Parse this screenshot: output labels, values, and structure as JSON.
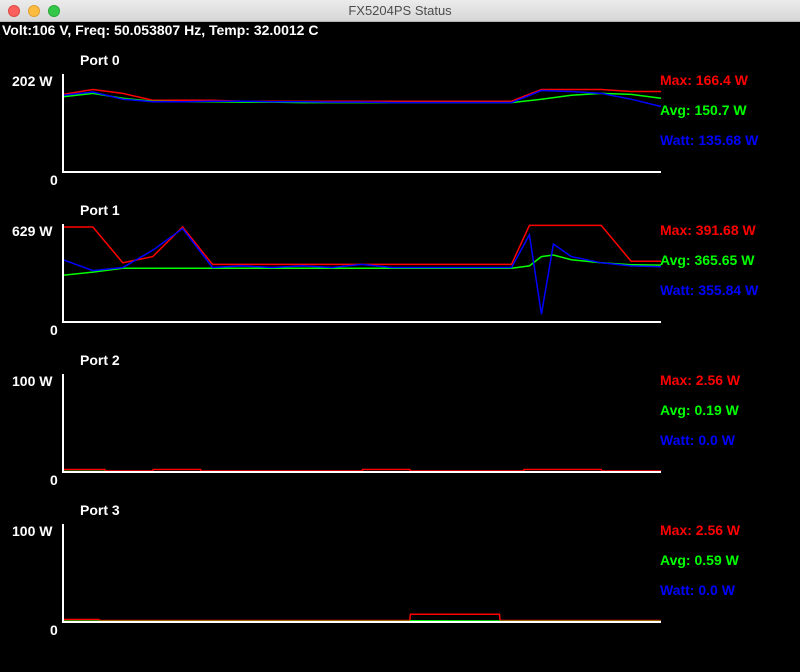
{
  "window": {
    "title": "FX5204PS Status"
  },
  "status": {
    "text": "Volt:106 V, Freq: 50.053807 Hz, Temp: 32.0012 C"
  },
  "colors": {
    "max": "#ff0000",
    "avg": "#00ff00",
    "watt": "#0000ff",
    "axis": "#ffffff"
  },
  "ports": [
    {
      "title": "Port 0",
      "ymax_label": "202 W",
      "yzero_label": "0",
      "max_label": "Max: 166.4 W",
      "avg_label": "Avg: 150.7 W",
      "watt_label": "Watt: 135.68 W"
    },
    {
      "title": "Port 1",
      "ymax_label": "629 W",
      "yzero_label": "0",
      "max_label": "Max: 391.68 W",
      "avg_label": "Avg: 365.65 W",
      "watt_label": "Watt: 355.84 W"
    },
    {
      "title": "Port 2",
      "ymax_label": "100 W",
      "yzero_label": "0",
      "max_label": "Max: 2.56 W",
      "avg_label": "Avg: 0.19 W",
      "watt_label": "Watt: 0.0 W"
    },
    {
      "title": "Port 3",
      "ymax_label": "100 W",
      "yzero_label": "0",
      "max_label": "Max: 2.56 W",
      "avg_label": "Avg: 0.59 W",
      "watt_label": "Watt: 0.0 W"
    }
  ],
  "chart_data": [
    {
      "type": "line",
      "title": "Port 0",
      "ylim": [
        0,
        202
      ],
      "x": [
        0,
        5,
        10,
        15,
        20,
        25,
        30,
        35,
        40,
        45,
        50,
        55,
        60,
        65,
        70,
        75,
        80,
        85,
        90,
        95,
        100
      ],
      "series": [
        {
          "name": "Max",
          "values": [
            160,
            170,
            162,
            148,
            148,
            148,
            146,
            146,
            146,
            146,
            146,
            146,
            146,
            146,
            146,
            146,
            170,
            170,
            170,
            166,
            166
          ]
        },
        {
          "name": "Avg",
          "values": [
            155,
            162,
            152,
            146,
            145,
            145,
            144,
            144,
            143,
            143,
            143,
            143,
            143,
            143,
            143,
            143,
            150,
            158,
            162,
            160,
            152
          ]
        },
        {
          "name": "Watt",
          "values": [
            158,
            165,
            150,
            145,
            145,
            146,
            146,
            145,
            145,
            144,
            144,
            143,
            143,
            143,
            143,
            143,
            168,
            166,
            162,
            150,
            135
          ]
        }
      ]
    },
    {
      "type": "line",
      "title": "Port 1",
      "ylim": [
        0,
        629
      ],
      "x": [
        0,
        5,
        10,
        15,
        20,
        25,
        30,
        35,
        40,
        45,
        50,
        55,
        60,
        65,
        70,
        75,
        78,
        80,
        82,
        85,
        90,
        95,
        100
      ],
      "series": [
        {
          "name": "Max",
          "values": [
            610,
            610,
            380,
            420,
            610,
            370,
            370,
            370,
            370,
            370,
            370,
            370,
            370,
            370,
            370,
            370,
            620,
            620,
            620,
            620,
            620,
            390,
            390
          ]
        },
        {
          "name": "Avg",
          "values": [
            300,
            320,
            345,
            345,
            345,
            345,
            345,
            345,
            345,
            345,
            345,
            345,
            345,
            345,
            345,
            345,
            360,
            420,
            430,
            400,
            380,
            368,
            365
          ]
        },
        {
          "name": "Watt",
          "values": [
            400,
            330,
            350,
            460,
            600,
            350,
            360,
            350,
            360,
            350,
            370,
            350,
            350,
            350,
            350,
            350,
            560,
            50,
            500,
            420,
            380,
            360,
            355
          ]
        }
      ]
    },
    {
      "type": "line",
      "title": "Port 2",
      "ylim": [
        0,
        100
      ],
      "x": [
        0,
        7,
        7.1,
        15,
        15.1,
        23,
        23.1,
        50,
        50.1,
        58,
        58.1,
        77,
        77.1,
        90,
        90.1,
        100
      ],
      "series": [
        {
          "name": "Max",
          "values": [
            2.56,
            2.56,
            1,
            1,
            2.56,
            2.56,
            1,
            1,
            2.56,
            2.56,
            1,
            1,
            2.56,
            2.56,
            1,
            1
          ]
        },
        {
          "name": "Avg",
          "values": [
            0.5,
            0.5,
            0.2,
            0.2,
            0.3,
            0.3,
            0.2,
            0.2,
            0.3,
            0.3,
            0.1,
            0.1,
            0.3,
            0.3,
            0.2,
            0.19
          ]
        },
        {
          "name": "Watt",
          "values": [
            0,
            0,
            0,
            0,
            0,
            0,
            0,
            0,
            0,
            0,
            0,
            0,
            0,
            0,
            0,
            0
          ]
        }
      ]
    },
    {
      "type": "line",
      "title": "Port 3",
      "ylim": [
        0,
        100
      ],
      "x": [
        0,
        6,
        6.1,
        58,
        58.1,
        73,
        73.1,
        100
      ],
      "series": [
        {
          "name": "Max",
          "values": [
            2.56,
            2.56,
            1.5,
            1.5,
            8,
            8,
            1.5,
            1.5
          ]
        },
        {
          "name": "Avg",
          "values": [
            0.7,
            0.7,
            0.6,
            0.6,
            1.2,
            1.0,
            0.6,
            0.59
          ]
        },
        {
          "name": "Watt",
          "values": [
            0,
            0,
            0,
            0,
            0,
            0,
            0,
            0
          ]
        }
      ]
    }
  ]
}
